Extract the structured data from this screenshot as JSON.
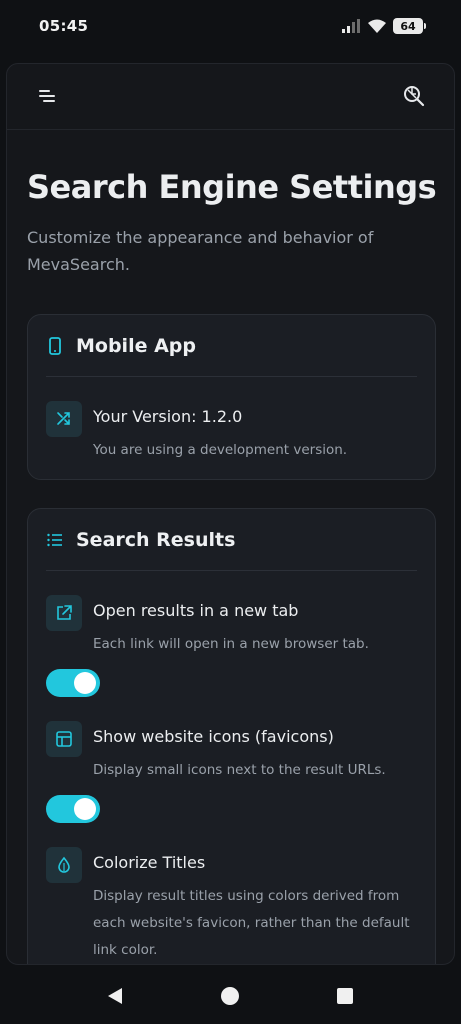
{
  "status": {
    "time": "05:45",
    "battery": "64"
  },
  "page": {
    "title": "Search Engine Settings",
    "description": "Customize the appearance and behavior of MevaSearch."
  },
  "mobile_card": {
    "title": "Mobile App",
    "version_title": "Your Version: 1.2.0",
    "version_desc": "You are using a development version."
  },
  "results_card": {
    "title": "Search Results",
    "settings": [
      {
        "title": "Open results in a new tab",
        "desc": "Each link will open in a new browser tab.",
        "enabled": true
      },
      {
        "title": "Show website icons (favicons)",
        "desc": "Display small icons next to the result URLs.",
        "enabled": true
      },
      {
        "title": "Colorize Titles",
        "desc": "Display result titles using colors derived from each website's favicon, rather than the default link color."
      }
    ]
  },
  "colors": {
    "accent": "#22c7dd",
    "background": "#0f1114",
    "card": "#1b1e24"
  },
  "icons": [
    "menu-icon",
    "search-settings-icon",
    "phone-icon",
    "shuffle-icon",
    "list-icon",
    "external-link-icon",
    "layout-icon",
    "droplet-icon",
    "back-icon",
    "home-icon",
    "recents-icon"
  ]
}
